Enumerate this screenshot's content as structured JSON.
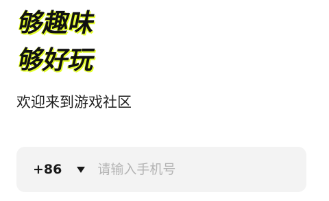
{
  "headline": {
    "line1": "够趣味",
    "line2": "够好玩"
  },
  "subtitle": "欢迎来到游戏社区",
  "phone_form": {
    "country_code": "+86",
    "dropdown_icon": "caret-down-icon",
    "placeholder": "请输入手机号",
    "value": ""
  },
  "colors": {
    "headline_highlight": "#e6ff2b",
    "input_background": "#f3f3f3",
    "placeholder_text": "#b4b4b4"
  }
}
